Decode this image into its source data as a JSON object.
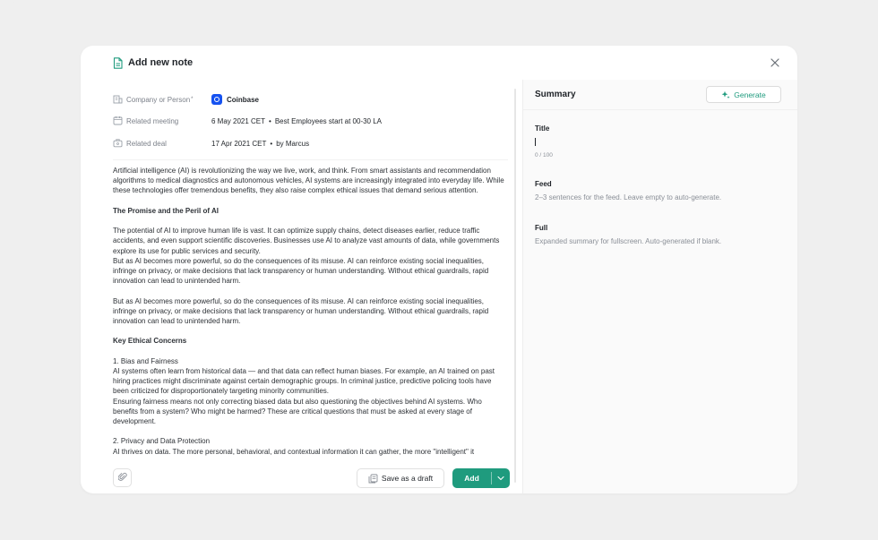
{
  "modal": {
    "title": "Add new note"
  },
  "meta": {
    "company": {
      "label": "Company or Person",
      "required_mark": "*",
      "value": "Coinbase"
    },
    "meeting": {
      "label": "Related meeting",
      "date": "6 May 2021 CET",
      "separator": "•",
      "name": "Best Employees start at 00-30 LA"
    },
    "deal": {
      "label": "Related deal",
      "date": "17 Apr 2021 CET",
      "separator": "•",
      "owner": "by Marcus"
    }
  },
  "body": {
    "intro": "Artificial intelligence (AI) is revolutionizing the way we live, work, and think. From smart assistants and recommendation algorithms to medical diagnostics and autonomous vehicles, AI systems are increasingly integrated into everyday life. While these technologies offer tremendous benefits, they also raise complex ethical issues that demand serious attention.",
    "heading1": "The Promise and the Peril of AI",
    "p1": "The potential of AI to improve human life is vast. It can optimize supply chains, detect diseases earlier, reduce traffic accidents, and even support scientific discoveries. Businesses use AI to analyze vast amounts of data, while governments explore its use for public services and security.",
    "p2": "But as AI becomes more powerful, so do the consequences of its misuse. AI can reinforce existing social inequalities, infringe on privacy, or make decisions that lack transparency or human understanding. Without ethical guardrails, rapid innovation can lead to unintended harm.",
    "p3": "But as AI becomes more powerful, so do the consequences of its misuse. AI can reinforce existing social inequalities, infringe on privacy, or make decisions that lack transparency or human understanding. Without ethical guardrails, rapid innovation can lead to unintended harm.",
    "heading2": "Key Ethical Concerns",
    "sub1": "1. Bias and Fairness",
    "p4": "AI systems often learn from historical data — and that data can reflect human biases. For example, an AI trained on past hiring practices might discriminate against certain demographic groups. In criminal justice, predictive policing tools have been criticized for disproportionately targeting minority communities.",
    "p5": "Ensuring fairness means not only correcting biased data but also questioning the objectives behind AI systems. Who benefits from a system? Who might be harmed? These are critical questions that must be asked at every stage of development.",
    "sub2": "2. Privacy and Data Protection",
    "p6": "AI thrives on data. The more personal, behavioral, and contextual information it can gather, the more \"intelligent\" it"
  },
  "footer": {
    "draft_label": "Save as a draft",
    "add_label": "Add"
  },
  "summary": {
    "title": "Summary",
    "generate_label": "Generate",
    "title_field": {
      "label": "Title",
      "counter": "0 / 100"
    },
    "feed_field": {
      "label": "Feed",
      "placeholder": "2–3 sentences for the feed. Leave empty to auto-generate."
    },
    "full_field": {
      "label": "Full",
      "placeholder": "Expanded summary for fullscreen. Auto-generated if blank."
    }
  },
  "colors": {
    "accent": "#1f9b7e",
    "coinbase": "#1652f0",
    "muted_text": "#7c818a"
  },
  "icons": [
    "document-icon",
    "close-icon",
    "building-icon",
    "calendar-icon",
    "briefcase-icon",
    "coinbase-logo",
    "paperclip-icon",
    "drafts-icon",
    "chevron-down-icon",
    "sparkle-icon"
  ]
}
